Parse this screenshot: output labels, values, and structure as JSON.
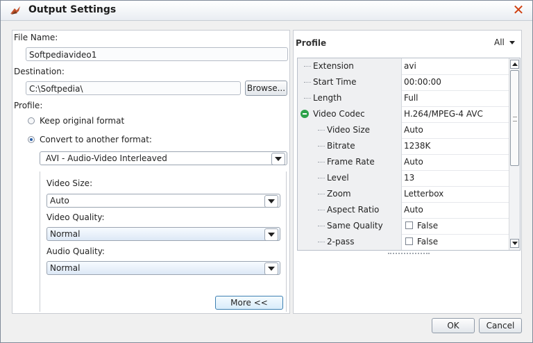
{
  "window": {
    "title": "Output Settings"
  },
  "left": {
    "file_name_label": "File Name:",
    "file_name_value": "Softpediavideo1",
    "destination_label": "Destination:",
    "destination_value": "C:\\Softpedia\\",
    "browse_label": "Browse...",
    "profile_label": "Profile:",
    "keep_original_label": "Keep original format",
    "convert_label": "Convert to another format:",
    "format_value": "AVI - Audio-Video Interleaved",
    "video_size_label": "Video Size:",
    "video_size_value": "Auto",
    "video_quality_label": "Video Quality:",
    "video_quality_value": "Normal",
    "audio_quality_label": "Audio Quality:",
    "audio_quality_value": "Normal",
    "more_label": "More <<"
  },
  "right": {
    "profile_title": "Profile",
    "filter_value": "All",
    "rows": [
      {
        "key": "Extension",
        "value": "avi"
      },
      {
        "key": "Start Time",
        "value": "00:00:00"
      },
      {
        "key": "Length",
        "value": "Full"
      },
      {
        "key": "Video Codec",
        "value": "H.264/MPEG-4 AVC"
      },
      {
        "key": "Video Size",
        "value": "Auto"
      },
      {
        "key": "Bitrate",
        "value": "1238K"
      },
      {
        "key": "Frame Rate",
        "value": "Auto"
      },
      {
        "key": "Level",
        "value": "13"
      },
      {
        "key": "Zoom",
        "value": "Letterbox"
      },
      {
        "key": "Aspect Ratio",
        "value": "Auto"
      },
      {
        "key": "Same Quality",
        "value": "False"
      },
      {
        "key": "2-pass",
        "value": "False"
      }
    ]
  },
  "footer": {
    "ok_label": "OK",
    "cancel_label": "Cancel"
  },
  "colors": {
    "close": "#d04010",
    "accent": "#2b5fa6",
    "codec_icon": "#2da24a"
  }
}
